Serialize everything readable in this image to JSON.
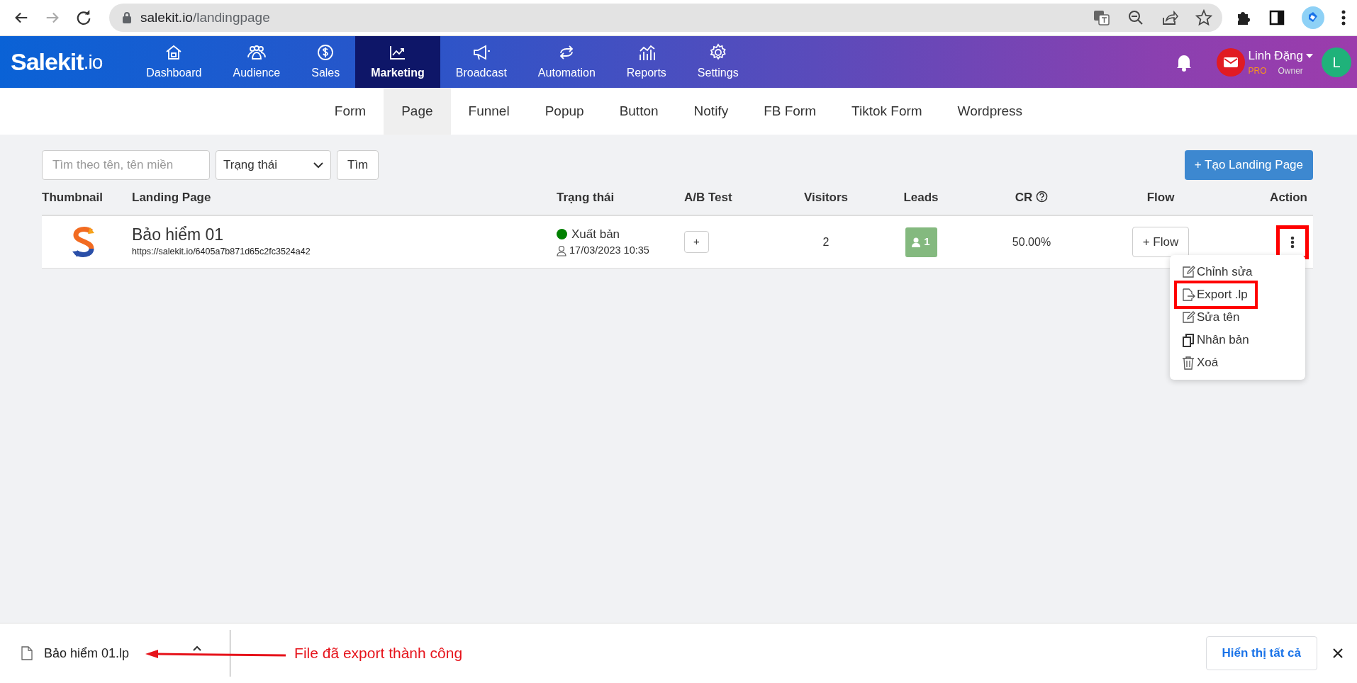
{
  "browser": {
    "url_host": "salekit.io",
    "url_path": "/landingpage",
    "back_disabled": false,
    "forward_disabled": true
  },
  "nav": {
    "logo": {
      "main": "Salekit",
      "suffix": ".io"
    },
    "items": [
      {
        "label": "Dashboard",
        "selected": false
      },
      {
        "label": "Audience",
        "selected": false
      },
      {
        "label": "Sales",
        "selected": false
      },
      {
        "label": "Marketing",
        "selected": true
      },
      {
        "label": "Broadcast",
        "selected": false
      },
      {
        "label": "Automation",
        "selected": false
      },
      {
        "label": "Reports",
        "selected": false
      },
      {
        "label": "Settings",
        "selected": false
      }
    ],
    "user": {
      "name": "Linh Đặng",
      "plan": "PRO",
      "role": "Owner",
      "avatar": "L"
    }
  },
  "subnav": [
    {
      "label": "Form",
      "selected": false
    },
    {
      "label": "Page",
      "selected": true
    },
    {
      "label": "Funnel",
      "selected": false
    },
    {
      "label": "Popup",
      "selected": false
    },
    {
      "label": "Button",
      "selected": false
    },
    {
      "label": "Notify",
      "selected": false
    },
    {
      "label": "FB Form",
      "selected": false
    },
    {
      "label": "Tiktok Form",
      "selected": false
    },
    {
      "label": "Wordpress",
      "selected": false
    }
  ],
  "filters": {
    "search": {
      "placeholder": "Tìm theo tên, tên miền"
    },
    "status_select": "Trạng thái",
    "search_button": "Tìm",
    "create_button": "+ Tạo Landing Page"
  },
  "table": {
    "columns": [
      "Thumbnail",
      "Landing Page",
      "Trạng thái",
      "A/B Test",
      "Visitors",
      "Leads",
      "CR",
      "Flow",
      "Action"
    ],
    "rows": [
      {
        "name": "Bảo hiểm 01",
        "url": "https://salekit.io/6405a7b871d65c2fc3524a42",
        "status": "Xuất bản",
        "published": true,
        "date": "17/03/2023 10:35",
        "ab_button": "+",
        "visitors": "2",
        "leads": "1",
        "cr": "50.00%",
        "flow_button": "+ Flow",
        "action_highlighted": true
      }
    ]
  },
  "action_menu": [
    {
      "label": "Chỉnh sửa",
      "kind": "edit",
      "highlighted": false
    },
    {
      "label": "Export .lp",
      "kind": "export",
      "highlighted": true
    },
    {
      "label": "Sửa tên",
      "kind": "edit",
      "highlighted": false
    },
    {
      "label": "Nhân bản",
      "kind": "copy",
      "highlighted": false
    },
    {
      "label": "Xoá",
      "kind": "trash",
      "highlighted": false
    }
  ],
  "download_bar": {
    "file_name": "Bảo hiểm 01.lp",
    "annotation": "File đã export thành công",
    "show_all": "Hiển thị tất cả"
  }
}
